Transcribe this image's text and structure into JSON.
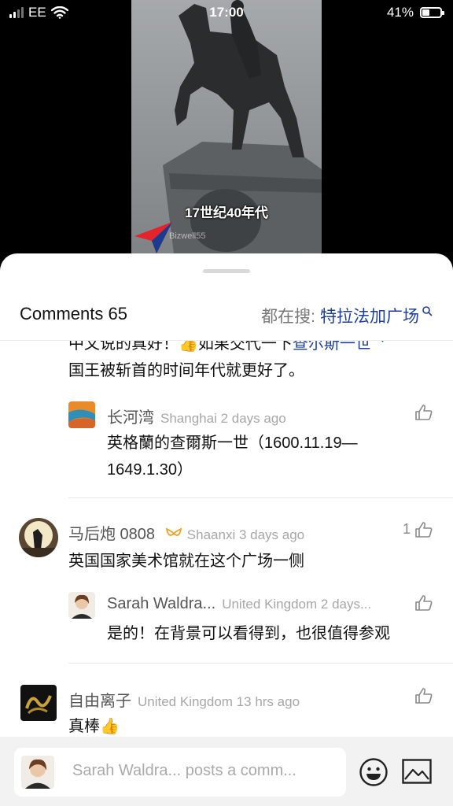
{
  "status": {
    "carrier": "EE",
    "time": "17:00",
    "battery": "41%",
    "battery_level": 0.41
  },
  "video": {
    "caption": "17世纪40年代",
    "watermark": "Bizwell55"
  },
  "comments": {
    "title": "Comments 65",
    "search_prefix": "都在搜:",
    "search_keyword": "特拉法加广场"
  },
  "items": {
    "partial": {
      "line1": "中文说的真好！👍如果交代一下",
      "link": "查尔斯一世",
      "line2": "国王被斩首的时间年代就更好了。"
    },
    "reply1": {
      "name": "长河湾",
      "meta": "Shanghai 2 days ago",
      "text1": "英格蘭的查爾斯一世（1600.11.19—",
      "text2": "1649.1.30）"
    },
    "c2": {
      "name": "马后炮 0808",
      "meta": "Shaanxi 3 days ago",
      "likes": "1",
      "text": "英国国家美术馆就在这个广场一侧"
    },
    "reply2": {
      "name": "Sarah Waldra...",
      "meta": "United Kingdom 2 days...",
      "text": "是的！在背景可以看得到，也很值得参观"
    },
    "c3": {
      "name": "自由离子",
      "meta": "United Kingdom 13 hrs ago",
      "text": "真棒👍"
    }
  },
  "composer": {
    "placeholder": "Sarah Waldra... posts a comm..."
  },
  "icons": [
    "signal-icon",
    "wifi-icon",
    "battery-icon",
    "search-icon",
    "like-icon",
    "emoji-icon",
    "image-icon",
    "badge-icon"
  ]
}
